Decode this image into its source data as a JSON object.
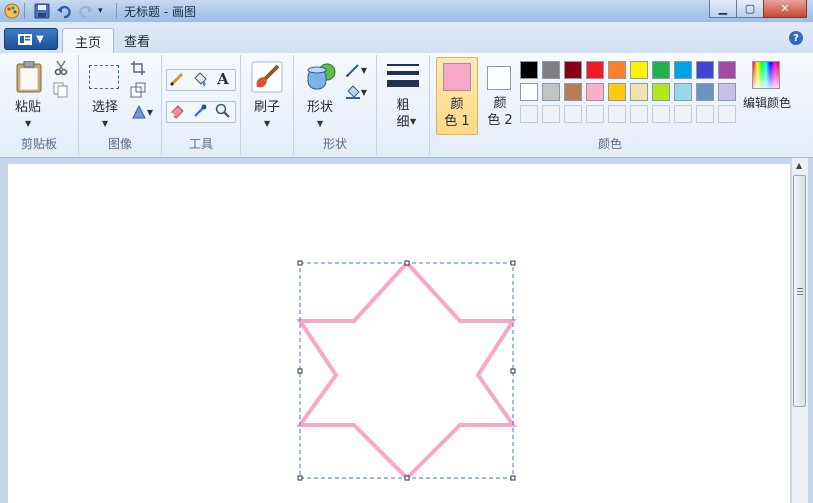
{
  "window": {
    "title": "无标题 - 画图"
  },
  "tabs": {
    "home": "主页",
    "view": "查看"
  },
  "clipboard": {
    "paste": "粘贴",
    "group": "剪贴板"
  },
  "image": {
    "select": "选择",
    "group": "图像"
  },
  "tools": {
    "group": "工具"
  },
  "brushes": {
    "label": "刷子"
  },
  "shapes": {
    "label": "形状",
    "group": "形状"
  },
  "size": {
    "line1": "粗",
    "line2": "细"
  },
  "colors": {
    "color1_line1": "颜",
    "color1_line2": "色 1",
    "color2_line1": "颜",
    "color2_line2": "色 2",
    "edit": "编辑颜色",
    "group": "颜色",
    "color1": "#f7a8c8",
    "color2": "#ffffff",
    "palette_row1": [
      "#000000",
      "#7f7f7f",
      "#880015",
      "#ed1c24",
      "#ff7f27",
      "#fff200",
      "#22b14c",
      "#00a2e8",
      "#3f48cc",
      "#a349a4"
    ],
    "palette_row2": [
      "#ffffff",
      "#c3c3c3",
      "#b97a57",
      "#ffaec9",
      "#ffc90e",
      "#efe4b0",
      "#b5e61d",
      "#99d9ea",
      "#7092be",
      "#c8bfe7"
    ]
  },
  "canvas": {
    "star_color": "#f7a8c8"
  }
}
